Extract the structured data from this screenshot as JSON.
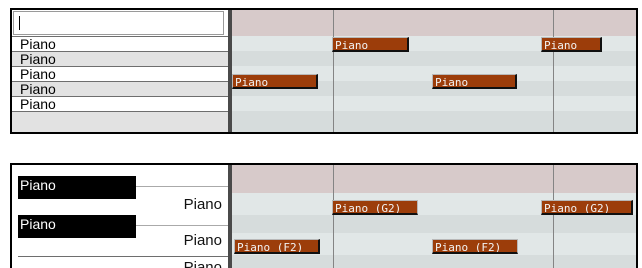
{
  "panel1": {
    "rows": [
      "Piano",
      "Piano",
      "Piano",
      "Piano",
      "Piano"
    ],
    "notes": [
      {
        "label": "Piano",
        "color": "#9c3d0a"
      },
      {
        "label": "Piano",
        "color": "#9c3d0a"
      },
      {
        "label": "Piano",
        "color": "#9c3d0a"
      },
      {
        "label": "Piano",
        "color": "#9c3d0a"
      }
    ]
  },
  "panel2": {
    "black_labels": [
      "Piano",
      "Piano"
    ],
    "right_labels": [
      "Piano",
      "Piano",
      "Piano"
    ],
    "notes": [
      {
        "label": "Piano (G2)"
      },
      {
        "label": "Piano (G2)"
      },
      {
        "label": "Piano (F2)"
      },
      {
        "label": "Piano (F2)"
      }
    ]
  },
  "colors": {
    "note_fill": "#9c3d0a",
    "header_lane": "#d7caca",
    "lane_a": "#e1e7e7",
    "lane_b": "#d6dcdc",
    "divider": "#4a4a4a"
  }
}
